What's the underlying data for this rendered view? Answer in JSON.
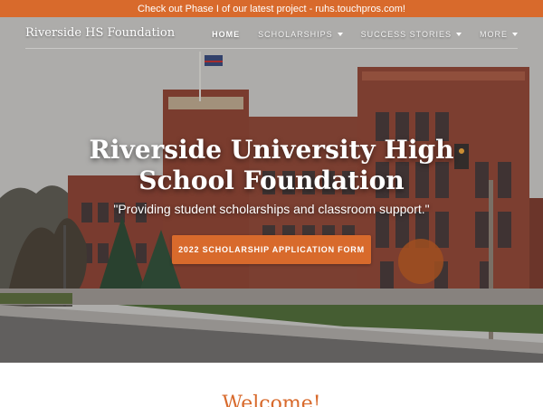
{
  "announcement": "Check out Phase I of our latest project - ruhs.touchpros.com!",
  "brand": "Riverside HS Foundation",
  "menu": [
    {
      "label": "HOME",
      "active": true,
      "dropdown": false
    },
    {
      "label": "SCHOLARSHIPS",
      "active": false,
      "dropdown": true
    },
    {
      "label": "SUCCESS STORIES",
      "active": false,
      "dropdown": true
    },
    {
      "label": "MORE",
      "active": false,
      "dropdown": true
    }
  ],
  "hero": {
    "title_line1": "Riverside University High",
    "title_line2": "School Foundation",
    "subtitle": "\"Providing student scholarships and classroom support.\"",
    "cta": "2022 SCHOLARSHIP APPLICATION FORM"
  },
  "welcome": "Welcome!",
  "colors": {
    "accent": "#d86a2c",
    "text_on_hero": "#ffffff"
  }
}
